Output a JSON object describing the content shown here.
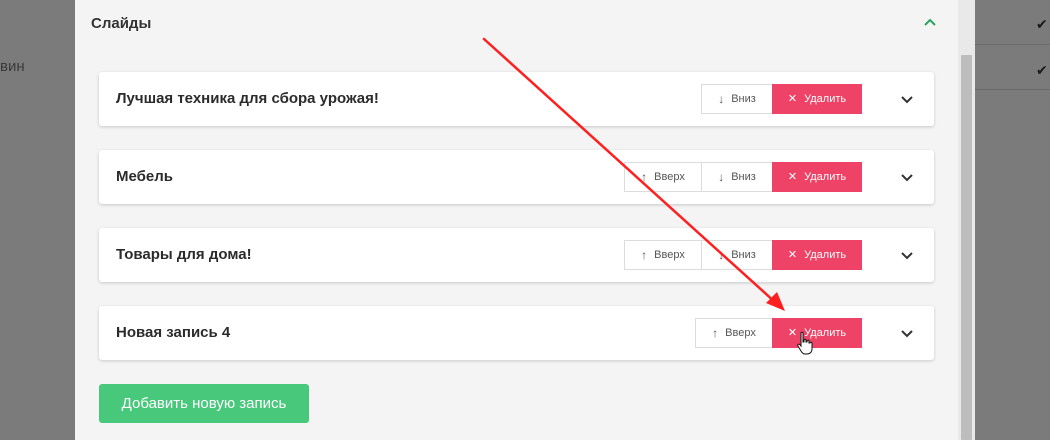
{
  "background": {
    "left_text": "вин"
  },
  "section": {
    "title": "Слайды"
  },
  "buttons": {
    "up_label": "Вверх",
    "down_label": "Вниз",
    "delete_label": "Удалить"
  },
  "slides": [
    {
      "title": "Лучшая техника для сбора урожая!"
    },
    {
      "title": "Мебель"
    },
    {
      "title": "Товары для дома!"
    },
    {
      "title": "Новая запись 4"
    }
  ],
  "add_button": {
    "label": "Добавить новую запись"
  },
  "colors": {
    "accent_green": "#48c87b",
    "danger": "#ee4366",
    "chevron_up": "#2aa360",
    "annotation_arrow": "#ff1f1f"
  },
  "icons": {
    "up": "arrow-up-icon",
    "down": "arrow-down-icon",
    "delete": "close-icon",
    "expand": "chevron-down-icon",
    "collapse": "chevron-up-icon"
  }
}
